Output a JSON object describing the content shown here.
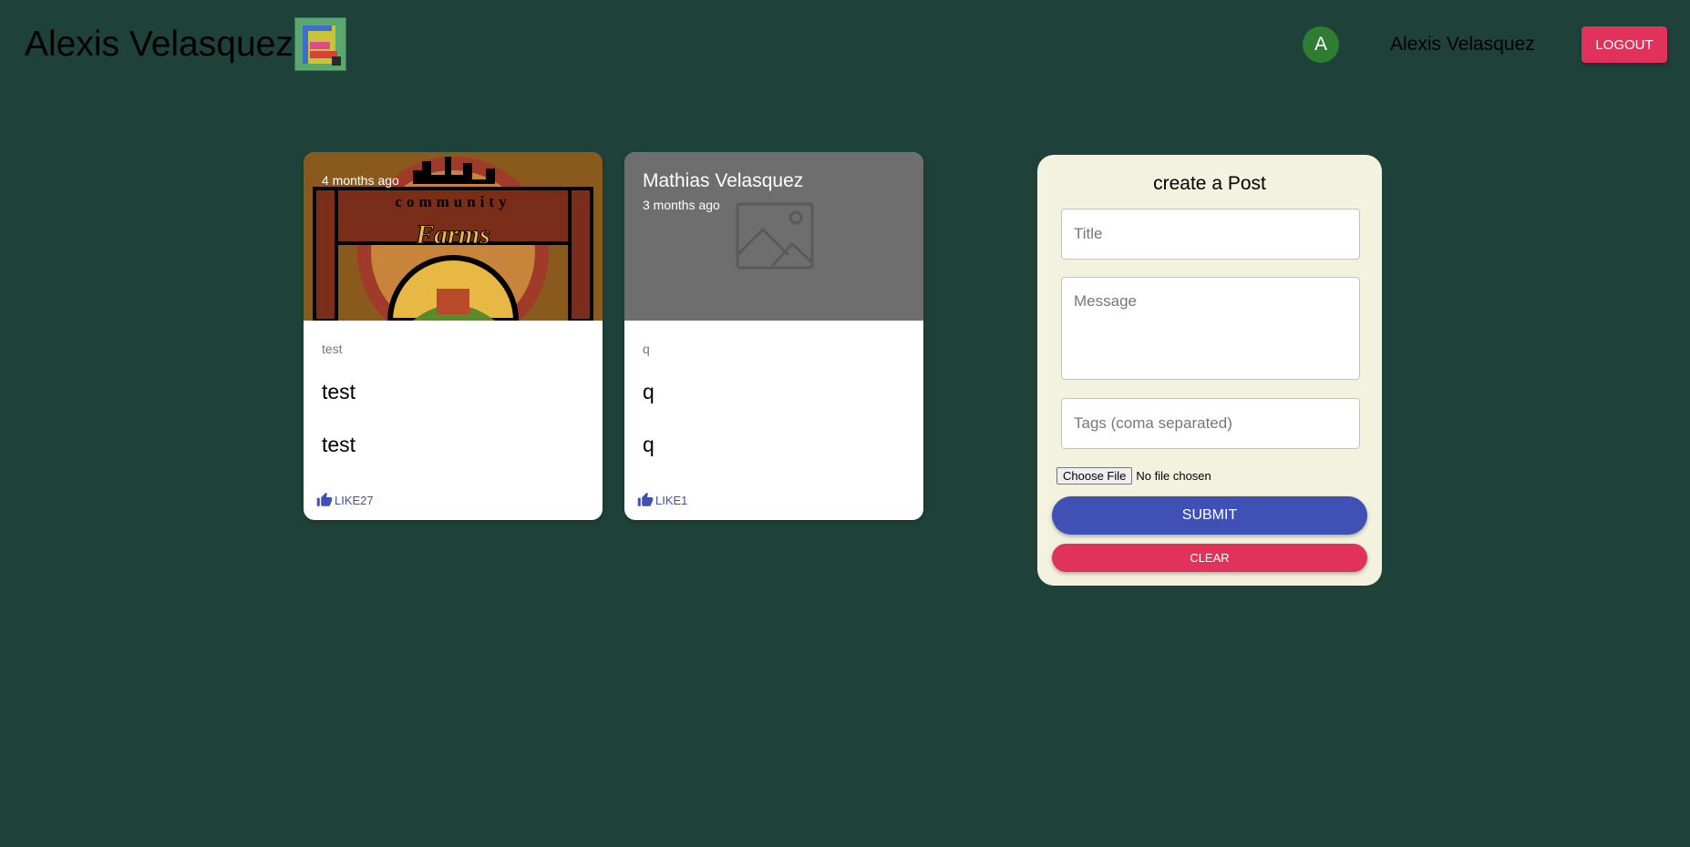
{
  "header": {
    "app_title": "Alexis Velasquez",
    "avatar_initial": "A",
    "user_name": "Alexis Velasquez",
    "logout_label": "LOGOUT"
  },
  "posts": [
    {
      "author": "",
      "time": "4 months ago",
      "tags": "test",
      "title": "test",
      "message": "test",
      "like_label": "LIKE27"
    },
    {
      "author": "Mathias Velasquez",
      "time": "3 months ago",
      "tags": "q",
      "title": "q",
      "message": "q",
      "like_label": "LIKE1"
    }
  ],
  "form": {
    "title": "create a Post",
    "title_placeholder": "Title",
    "message_placeholder": "Message",
    "tags_placeholder": "Tags (coma separated)",
    "choose_file_label": "Choose File",
    "file_status": "No file chosen",
    "submit_label": "SUBMIT",
    "clear_label": "CLEAR"
  },
  "colors": {
    "background": "#1e4239",
    "primary": "#3f51b5",
    "secondary": "#e0325a",
    "avatar": "#2e7d32",
    "form_bg": "#f3f2df"
  }
}
